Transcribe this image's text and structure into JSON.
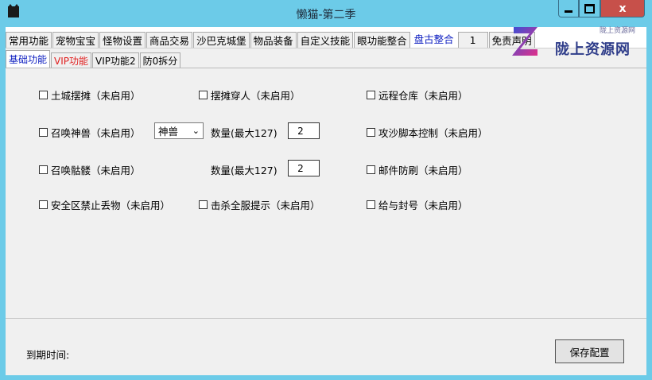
{
  "window": {
    "title": "懒猫-第二季",
    "close_glyph": "x"
  },
  "tabs_main": [
    {
      "label": "常用功能",
      "active": false
    },
    {
      "label": "宠物宝宝",
      "active": false
    },
    {
      "label": "怪物设置",
      "active": false
    },
    {
      "label": "商品交易",
      "active": false
    },
    {
      "label": "沙巴克城堡",
      "active": false
    },
    {
      "label": "物品装备",
      "active": false
    },
    {
      "label": "自定义技能",
      "active": false
    },
    {
      "label": "眼功能整合",
      "active": false
    },
    {
      "label": "盘古整合",
      "active": true
    },
    {
      "label": "1",
      "active": false
    },
    {
      "label": "免责声明",
      "active": false
    }
  ],
  "tabs_sub": [
    {
      "label": "基础功能",
      "active": true
    },
    {
      "label": "VIP功能",
      "active": false
    },
    {
      "label": "VIP功能2",
      "active": false
    },
    {
      "label": "防0拆分",
      "active": false
    }
  ],
  "options": {
    "tucheng_baitan": "土城摆摊（未启用）",
    "baitan_chuanren": "摆摊穿人（未启用）",
    "yuancheng_cangku": "远程仓库（未启用）",
    "zhaohuan_shenshou": "召唤神兽（未启用）",
    "gongsha_jiaoben": "攻沙脚本控制（未启用）",
    "zhaohuan_kulou": "召唤骷髅（未启用）",
    "youjian_fangshua": "邮件防刷（未启用）",
    "anquanqu_jinzhi": "安全区禁止丢物（未启用）",
    "jisha_tishi": "击杀全服提示（未启用）",
    "geiyu_fenghao": "给与封号（未启用）"
  },
  "shenshou_select": "神兽",
  "quantity_label": "数量(最大127)",
  "shenshou_qty": "2",
  "kulou_qty": "2",
  "expire_label": "到期时间:",
  "save_button": "保存配置",
  "watermark": {
    "text": "陇上资源网",
    "small": "陇上资源网"
  },
  "colors": {
    "titlebar": "#6ccbe8",
    "active_tab": "#0b1cc0",
    "vip_tab": "#e02020",
    "close_button": "#c7504a"
  }
}
